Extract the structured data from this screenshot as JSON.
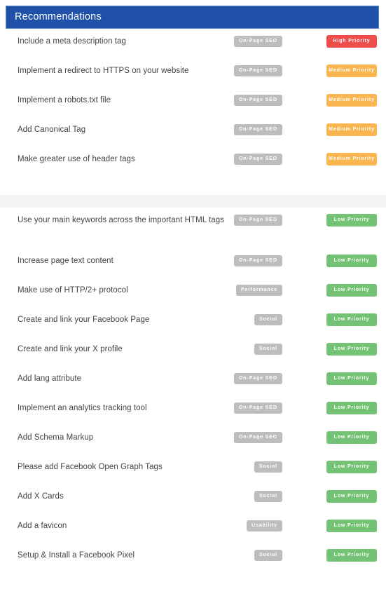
{
  "header": {
    "title": "Recommendations",
    "bar_color": "#1f51a8"
  },
  "colors": {
    "high": "#ef4c4c",
    "medium": "#f9b550",
    "low": "#74c274",
    "category_badge": "#bdbdbd",
    "divider_band": "#f4f4f5",
    "row_text": "#3f4448"
  },
  "sections": [
    {
      "rows": [
        {
          "label": "Include a meta description tag",
          "category": "On-Page SEO",
          "priority": "High Priority",
          "priority_level": "high"
        },
        {
          "label": "Implement a redirect to HTTPS on your website",
          "category": "On-Page SEO",
          "priority": "Medium Priority",
          "priority_level": "medium"
        },
        {
          "label": "Implement a robots.txt file",
          "category": "On-Page SEO",
          "priority": "Medium Priority",
          "priority_level": "medium"
        },
        {
          "label": "Add Canonical Tag",
          "category": "On-Page SEO",
          "priority": "Medium Priority",
          "priority_level": "medium"
        },
        {
          "label": "Make greater use of header tags",
          "category": "On-Page SEO",
          "priority": "Medium Priority",
          "priority_level": "medium"
        }
      ]
    },
    {
      "rows": [
        {
          "label": "Use your main keywords across the important HTML tags",
          "category": "On-Page SEO",
          "priority": "Low Priority",
          "priority_level": "low",
          "tall": true
        },
        {
          "label": "Increase page text content",
          "category": "On-Page SEO",
          "priority": "Low Priority",
          "priority_level": "low"
        },
        {
          "label": "Make use of HTTP/2+ protocol",
          "category": "Performance",
          "priority": "Low Priority",
          "priority_level": "low"
        },
        {
          "label": "Create and link your Facebook Page",
          "category": "Social",
          "priority": "Low Priority",
          "priority_level": "low"
        },
        {
          "label": "Create and link your X profile",
          "category": "Social",
          "priority": "Low Priority",
          "priority_level": "low"
        },
        {
          "label": "Add lang attribute",
          "category": "On-Page SEO",
          "priority": "Low Priority",
          "priority_level": "low"
        },
        {
          "label": "Implement an analytics tracking tool",
          "category": "On-Page SEO",
          "priority": "Low Priority",
          "priority_level": "low"
        },
        {
          "label": "Add Schema Markup",
          "category": "On-Page SEO",
          "priority": "Low Priority",
          "priority_level": "low"
        },
        {
          "label": "Please add Facebook Open Graph Tags",
          "category": "Social",
          "priority": "Low Priority",
          "priority_level": "low"
        },
        {
          "label": "Add X Cards",
          "category": "Social",
          "priority": "Low Priority",
          "priority_level": "low"
        },
        {
          "label": "Add a favicon",
          "category": "Usability",
          "priority": "Low Priority",
          "priority_level": "low"
        },
        {
          "label": "Setup & Install a Facebook Pixel",
          "category": "Social",
          "priority": "Low Priority",
          "priority_level": "low"
        }
      ]
    }
  ]
}
